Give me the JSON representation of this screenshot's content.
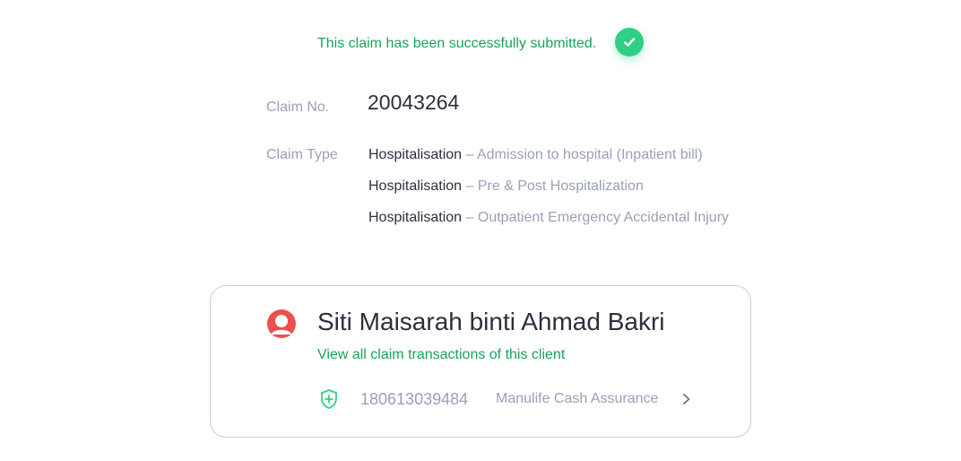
{
  "status": {
    "message": "This claim has been successfully submitted.",
    "icon": "check-circle-icon",
    "color": "#1aa260"
  },
  "claim": {
    "number_label": "Claim No.",
    "number": "20043264",
    "type_label": "Claim Type",
    "types": [
      {
        "category": "Hospitalisation",
        "separator": "–",
        "description": "Admission to hospital (Inpatient bill)"
      },
      {
        "category": "Hospitalisation",
        "separator": "–",
        "description": "Pre & Post Hospitalization"
      },
      {
        "category": "Hospitalisation",
        "separator": "–",
        "description": "Outpatient Emergency Accidental Injury"
      }
    ]
  },
  "client": {
    "avatar_icon": "user-avatar-icon",
    "name": "Siti Maisarah binti Ahmad Bakri",
    "link": "View all claim transactions of this client",
    "policy": {
      "icon": "shield-plus-icon",
      "number": "180613039484",
      "product": "Manulife Cash Assurance",
      "arrow_icon": "chevron-right-icon"
    }
  }
}
